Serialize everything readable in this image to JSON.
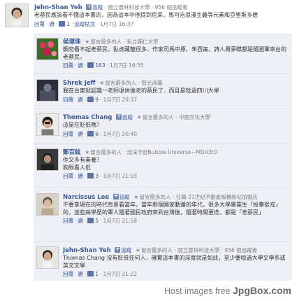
{
  "comments": [
    {
      "id": "c1",
      "name": "Jehn-Shan Yeh",
      "follow_label": "追蹤",
      "meta": "· 國立雲林科技大學 · 956 個追蹤者",
      "text": "老蔡民應該看不懂這本書的，因為這本中他提到尼采，馬可吉浪漫主義等元素和亞里斯多德",
      "actions": {
        "reply": "回覆",
        "like": "讚",
        "likes": "1",
        "reply_label": "追蹤貼文",
        "time": "1月7日 16:37"
      }
    },
    {
      "id": "c2",
      "name": "侯璟珠",
      "fav": "留言最多的人",
      "meta": "· 私立輔仁大學",
      "text": "鋼勿看不起老蔡民，臥虎藏龍很多，作家司馬中原、朱西甯、詩人周夢蝶都是隨國軍來台的老蔡民。",
      "actions": {
        "reply": "回覆",
        "like": "讚",
        "likes": "163",
        "time": "1月7日 16:55"
      }
    },
    {
      "id": "c3",
      "name": "Shrek Jeff",
      "fav": "留言最多的人",
      "meta": "· 智光商職",
      "text": "我在台東就認識一老師退休後老的蔡民了...而且是唸過四川大學",
      "actions": {
        "reply": "回覆",
        "like": "讚",
        "likes": "9",
        "time": "1月7日 20:37"
      }
    },
    {
      "id": "c4",
      "name": "Thomas Chang",
      "follow_label": "追蹤",
      "fav": "留言最多的人",
      "meta": "· 中國文化大學",
      "text": "這是在貶低嗎？",
      "actions": {
        "reply": "回覆",
        "like": "讚",
        "likes": "6",
        "time": "1月7日 20:40"
      }
    },
    {
      "id": "c5",
      "name": "鄭百鉉",
      "fav": "留言最多的人",
      "meta": "· 泡沫宇宙Bubble Universe－MD/CEO",
      "text": "你又多有素養？\n狗眼看人低",
      "actions": {
        "reply": "回覆",
        "like": "讚",
        "likes": "3",
        "time": "1月7日 21:03"
      }
    },
    {
      "id": "c6",
      "name": "Narcissus Lee",
      "follow_label": "追蹤",
      "fav": "留言最多的人",
      "meta": "· 任職 21世紀不動產板橋新站加盟店",
      "text": "不要拿現在的時代背景看當年，當年那個國家動盪的年代，很多大學畢業生「投筆從戎」的，這些高學歷的軍人隨著國民政府來到台灣後，隨著時間更迭，都是「老蔡民」",
      "actions": {
        "reply": "回覆",
        "like": "讚",
        "likes": "5",
        "time": "1月7日 21:18"
      }
    },
    {
      "id": "c7",
      "name": "Jehn-Shan Yeh",
      "follow_label": "追蹤",
      "fav": "留言最多的人",
      "meta": "· 國立雲林科技大學 · 956 個追蹤者",
      "text": "Thomas Chang 沒有貶低任何人，確實這本書的深度就是如此，至少要唸過大學文學系或英文文學",
      "actions": {
        "reply": "回覆",
        "like": "讚",
        "likes": "1",
        "time": "1月7日 21:22"
      }
    }
  ],
  "watermark": {
    "prefix": "Host images free",
    "brand": "JpgBox.com"
  },
  "colors": {
    "link": "#3b5998",
    "meta": "#7f7f7f",
    "reply_bg": "#eef0f5"
  }
}
